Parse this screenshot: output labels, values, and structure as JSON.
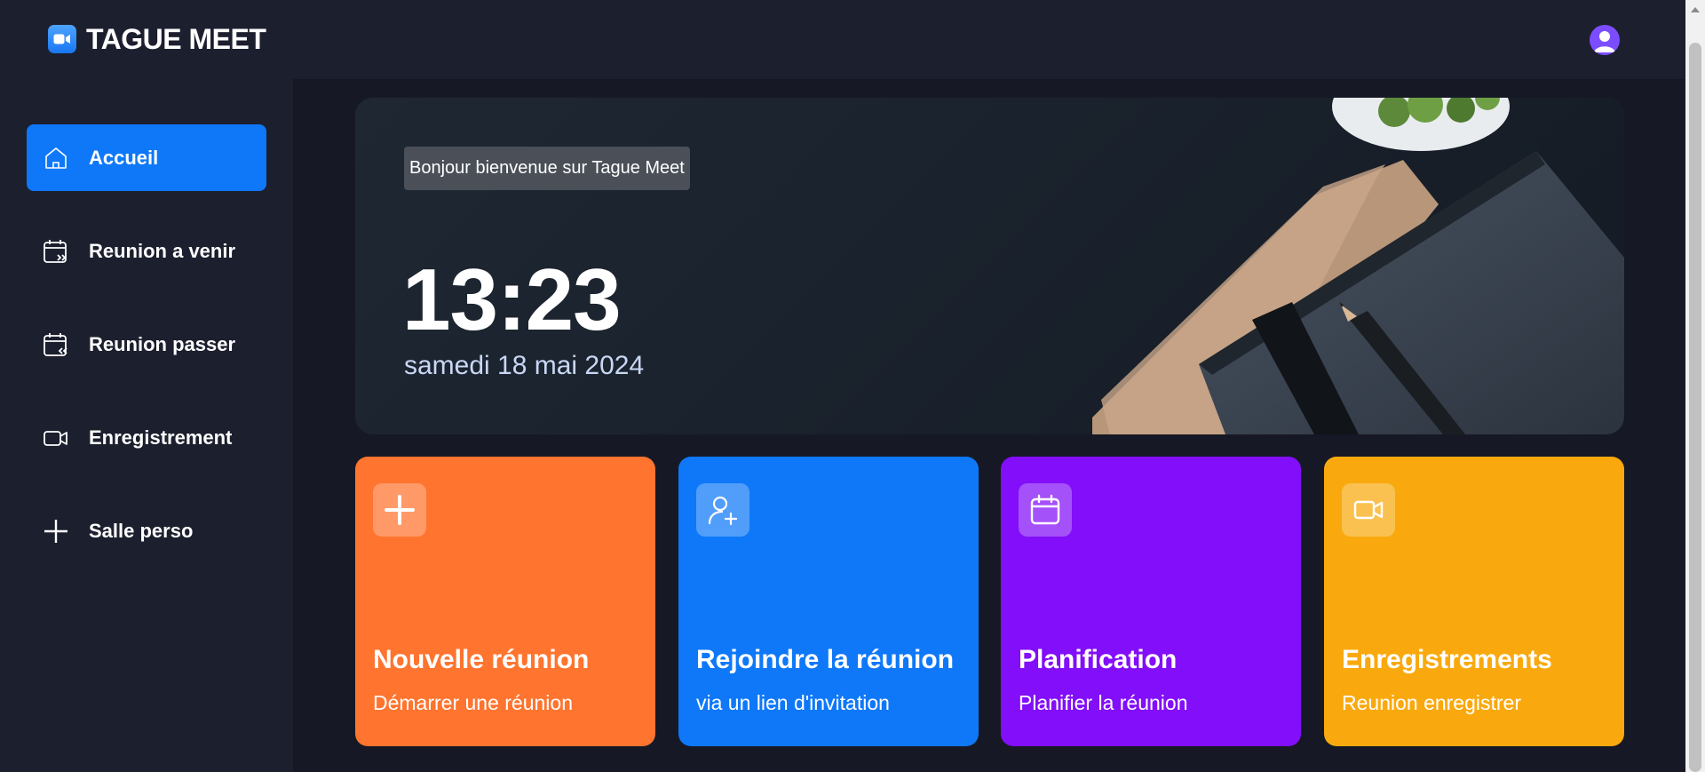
{
  "header": {
    "app_name": "TAGUE MEET",
    "logo_icon": "video-camera-icon",
    "avatar_icon": "user-icon",
    "avatar_color": "#7c4dff"
  },
  "sidebar": {
    "items": [
      {
        "label": "Accueil",
        "icon": "home-icon",
        "active": true
      },
      {
        "label": "Reunion a venir",
        "icon": "calendar-upcoming-icon",
        "active": false
      },
      {
        "label": "Reunion passer",
        "icon": "calendar-previous-icon",
        "active": false
      },
      {
        "label": "Enregistrement",
        "icon": "video-icon",
        "active": false
      },
      {
        "label": "Salle perso",
        "icon": "plus-icon",
        "active": false
      }
    ],
    "active_color": "#0e78f9"
  },
  "hero": {
    "greeting": "Bonjour bienvenue sur Tague Meet",
    "time": "13:23",
    "date": "samedi 18 mai 2024"
  },
  "cards": [
    {
      "title": "Nouvelle réunion",
      "subtitle": "Démarrer une réunion",
      "icon": "plus-icon",
      "color": "#ff742e"
    },
    {
      "title": "Rejoindre la réunion",
      "subtitle": "via un lien d'invitation",
      "icon": "user-plus-icon",
      "color": "#0e78f9"
    },
    {
      "title": "Planification",
      "subtitle": "Planifier la réunion",
      "icon": "calendar-icon",
      "color": "#830ef9"
    },
    {
      "title": "Enregistrements",
      "subtitle": "Reunion enregistrer",
      "icon": "video-icon",
      "color": "#f9a90e"
    }
  ]
}
